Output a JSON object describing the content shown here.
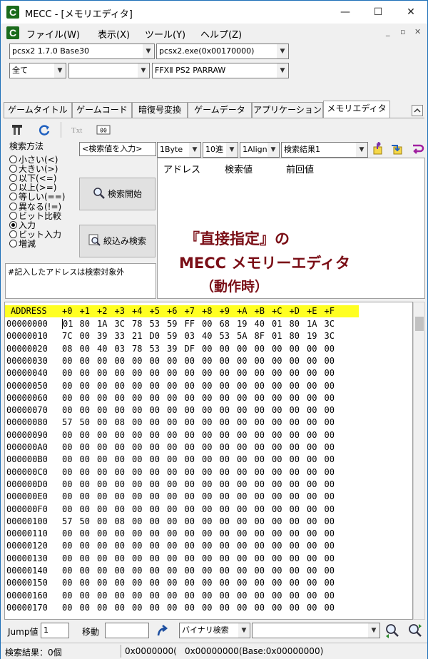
{
  "window": {
    "title": "MECC - [メモリエディタ]",
    "minimize": "—",
    "maximize": "☐",
    "close": "✕"
  },
  "menu": {
    "items": [
      "ファイル(W)",
      "表示(X)",
      "ツール(Y)",
      "ヘルプ(Z)"
    ],
    "mdi": [
      "_",
      "▫",
      "✕"
    ]
  },
  "selectors": {
    "emulator": "pcsx2 1.7.0 Base30",
    "process": "pcsx2.exe(0x00170000)",
    "filter": "全て",
    "filter2": "",
    "game": "FFXⅡ PS2 PARRAW"
  },
  "tabs": [
    "ゲームタイトル",
    "ゲームコード",
    "暗復号変換",
    "ゲームデータ",
    "アプリケーション",
    "メモリエディタ"
  ],
  "search": {
    "label": "検索方法",
    "input_placeholder": "<検索値を入力>",
    "size": "1Byte",
    "radix": "10進",
    "align": "1Align",
    "result_slot": "検索結果1",
    "methods": [
      "小さい(<)",
      "大きい(>)",
      "以下(<=)",
      "以上(>=)",
      "等しい(==)",
      "異なる(!=)",
      "ビット比較",
      "入力",
      "ビット入力",
      "増減"
    ],
    "selected": 7,
    "start_button": "検索開始",
    "narrow_button": "絞込み検索",
    "note": "#記入したアドレスは検索対象外"
  },
  "results": {
    "columns": [
      "アドレス",
      "検索値",
      "前回値"
    ]
  },
  "overlay": {
    "line1": "『直接指定』の",
    "line2": "MECC メモリーエディタ",
    "line3": "（動作時）"
  },
  "hex": {
    "header": [
      "ADDRESS",
      "+0",
      "+1",
      "+2",
      "+3",
      "+4",
      "+5",
      "+6",
      "+7",
      "+8",
      "+9",
      "+A",
      "+B",
      "+C",
      "+D",
      "+E",
      "+F"
    ],
    "rows": [
      {
        "addr": "00000000",
        "bytes": [
          "01",
          "80",
          "1A",
          "3C",
          "78",
          "53",
          "59",
          "FF",
          "00",
          "68",
          "19",
          "40",
          "01",
          "80",
          "1A",
          "3C"
        ]
      },
      {
        "addr": "00000010",
        "bytes": [
          "7C",
          "00",
          "39",
          "33",
          "21",
          "D0",
          "59",
          "03",
          "40",
          "53",
          "5A",
          "8F",
          "01",
          "80",
          "19",
          "3C"
        ]
      },
      {
        "addr": "00000020",
        "bytes": [
          "08",
          "00",
          "40",
          "03",
          "78",
          "53",
          "39",
          "DF",
          "00",
          "00",
          "00",
          "00",
          "00",
          "00",
          "00",
          "00"
        ]
      },
      {
        "addr": "00000030",
        "bytes": [
          "00",
          "00",
          "00",
          "00",
          "00",
          "00",
          "00",
          "00",
          "00",
          "00",
          "00",
          "00",
          "00",
          "00",
          "00",
          "00"
        ]
      },
      {
        "addr": "00000040",
        "bytes": [
          "00",
          "00",
          "00",
          "00",
          "00",
          "00",
          "00",
          "00",
          "00",
          "00",
          "00",
          "00",
          "00",
          "00",
          "00",
          "00"
        ]
      },
      {
        "addr": "00000050",
        "bytes": [
          "00",
          "00",
          "00",
          "00",
          "00",
          "00",
          "00",
          "00",
          "00",
          "00",
          "00",
          "00",
          "00",
          "00",
          "00",
          "00"
        ]
      },
      {
        "addr": "00000060",
        "bytes": [
          "00",
          "00",
          "00",
          "00",
          "00",
          "00",
          "00",
          "00",
          "00",
          "00",
          "00",
          "00",
          "00",
          "00",
          "00",
          "00"
        ]
      },
      {
        "addr": "00000070",
        "bytes": [
          "00",
          "00",
          "00",
          "00",
          "00",
          "00",
          "00",
          "00",
          "00",
          "00",
          "00",
          "00",
          "00",
          "00",
          "00",
          "00"
        ]
      },
      {
        "addr": "00000080",
        "bytes": [
          "57",
          "50",
          "00",
          "08",
          "00",
          "00",
          "00",
          "00",
          "00",
          "00",
          "00",
          "00",
          "00",
          "00",
          "00",
          "00"
        ]
      },
      {
        "addr": "00000090",
        "bytes": [
          "00",
          "00",
          "00",
          "00",
          "00",
          "00",
          "00",
          "00",
          "00",
          "00",
          "00",
          "00",
          "00",
          "00",
          "00",
          "00"
        ]
      },
      {
        "addr": "000000A0",
        "bytes": [
          "00",
          "00",
          "00",
          "00",
          "00",
          "00",
          "00",
          "00",
          "00",
          "00",
          "00",
          "00",
          "00",
          "00",
          "00",
          "00"
        ]
      },
      {
        "addr": "000000B0",
        "bytes": [
          "00",
          "00",
          "00",
          "00",
          "00",
          "00",
          "00",
          "00",
          "00",
          "00",
          "00",
          "00",
          "00",
          "00",
          "00",
          "00"
        ]
      },
      {
        "addr": "000000C0",
        "bytes": [
          "00",
          "00",
          "00",
          "00",
          "00",
          "00",
          "00",
          "00",
          "00",
          "00",
          "00",
          "00",
          "00",
          "00",
          "00",
          "00"
        ]
      },
      {
        "addr": "000000D0",
        "bytes": [
          "00",
          "00",
          "00",
          "00",
          "00",
          "00",
          "00",
          "00",
          "00",
          "00",
          "00",
          "00",
          "00",
          "00",
          "00",
          "00"
        ]
      },
      {
        "addr": "000000E0",
        "bytes": [
          "00",
          "00",
          "00",
          "00",
          "00",
          "00",
          "00",
          "00",
          "00",
          "00",
          "00",
          "00",
          "00",
          "00",
          "00",
          "00"
        ]
      },
      {
        "addr": "000000F0",
        "bytes": [
          "00",
          "00",
          "00",
          "00",
          "00",
          "00",
          "00",
          "00",
          "00",
          "00",
          "00",
          "00",
          "00",
          "00",
          "00",
          "00"
        ]
      },
      {
        "addr": "00000100",
        "bytes": [
          "57",
          "50",
          "00",
          "08",
          "00",
          "00",
          "00",
          "00",
          "00",
          "00",
          "00",
          "00",
          "00",
          "00",
          "00",
          "00"
        ]
      },
      {
        "addr": "00000110",
        "bytes": [
          "00",
          "00",
          "00",
          "00",
          "00",
          "00",
          "00",
          "00",
          "00",
          "00",
          "00",
          "00",
          "00",
          "00",
          "00",
          "00"
        ]
      },
      {
        "addr": "00000120",
        "bytes": [
          "00",
          "00",
          "00",
          "00",
          "00",
          "00",
          "00",
          "00",
          "00",
          "00",
          "00",
          "00",
          "00",
          "00",
          "00",
          "00"
        ]
      },
      {
        "addr": "00000130",
        "bytes": [
          "00",
          "00",
          "00",
          "00",
          "00",
          "00",
          "00",
          "00",
          "00",
          "00",
          "00",
          "00",
          "00",
          "00",
          "00",
          "00"
        ]
      },
      {
        "addr": "00000140",
        "bytes": [
          "00",
          "00",
          "00",
          "00",
          "00",
          "00",
          "00",
          "00",
          "00",
          "00",
          "00",
          "00",
          "00",
          "00",
          "00",
          "00"
        ]
      },
      {
        "addr": "00000150",
        "bytes": [
          "00",
          "00",
          "00",
          "00",
          "00",
          "00",
          "00",
          "00",
          "00",
          "00",
          "00",
          "00",
          "00",
          "00",
          "00",
          "00"
        ]
      },
      {
        "addr": "00000160",
        "bytes": [
          "00",
          "00",
          "00",
          "00",
          "00",
          "00",
          "00",
          "00",
          "00",
          "00",
          "00",
          "00",
          "00",
          "00",
          "00",
          "00"
        ]
      },
      {
        "addr": "00000170",
        "bytes": [
          "00",
          "00",
          "00",
          "00",
          "00",
          "00",
          "00",
          "00",
          "00",
          "00",
          "00",
          "00",
          "00",
          "00",
          "00",
          "00"
        ]
      }
    ]
  },
  "bottom": {
    "jump_label": "Jump値",
    "jump_value": "1",
    "move_label": "移動",
    "binary_search": "バイナリ検索",
    "binary_input": ""
  },
  "status": {
    "count": "検索結果：0個",
    "addr1": "0x0000000(",
    "addr2": "0x00000000(Base:0x00000000)"
  },
  "colors": {
    "header_highlight": "#ffff22",
    "overlay_text": "#7a0e16",
    "accent": "#1e6fb8"
  }
}
